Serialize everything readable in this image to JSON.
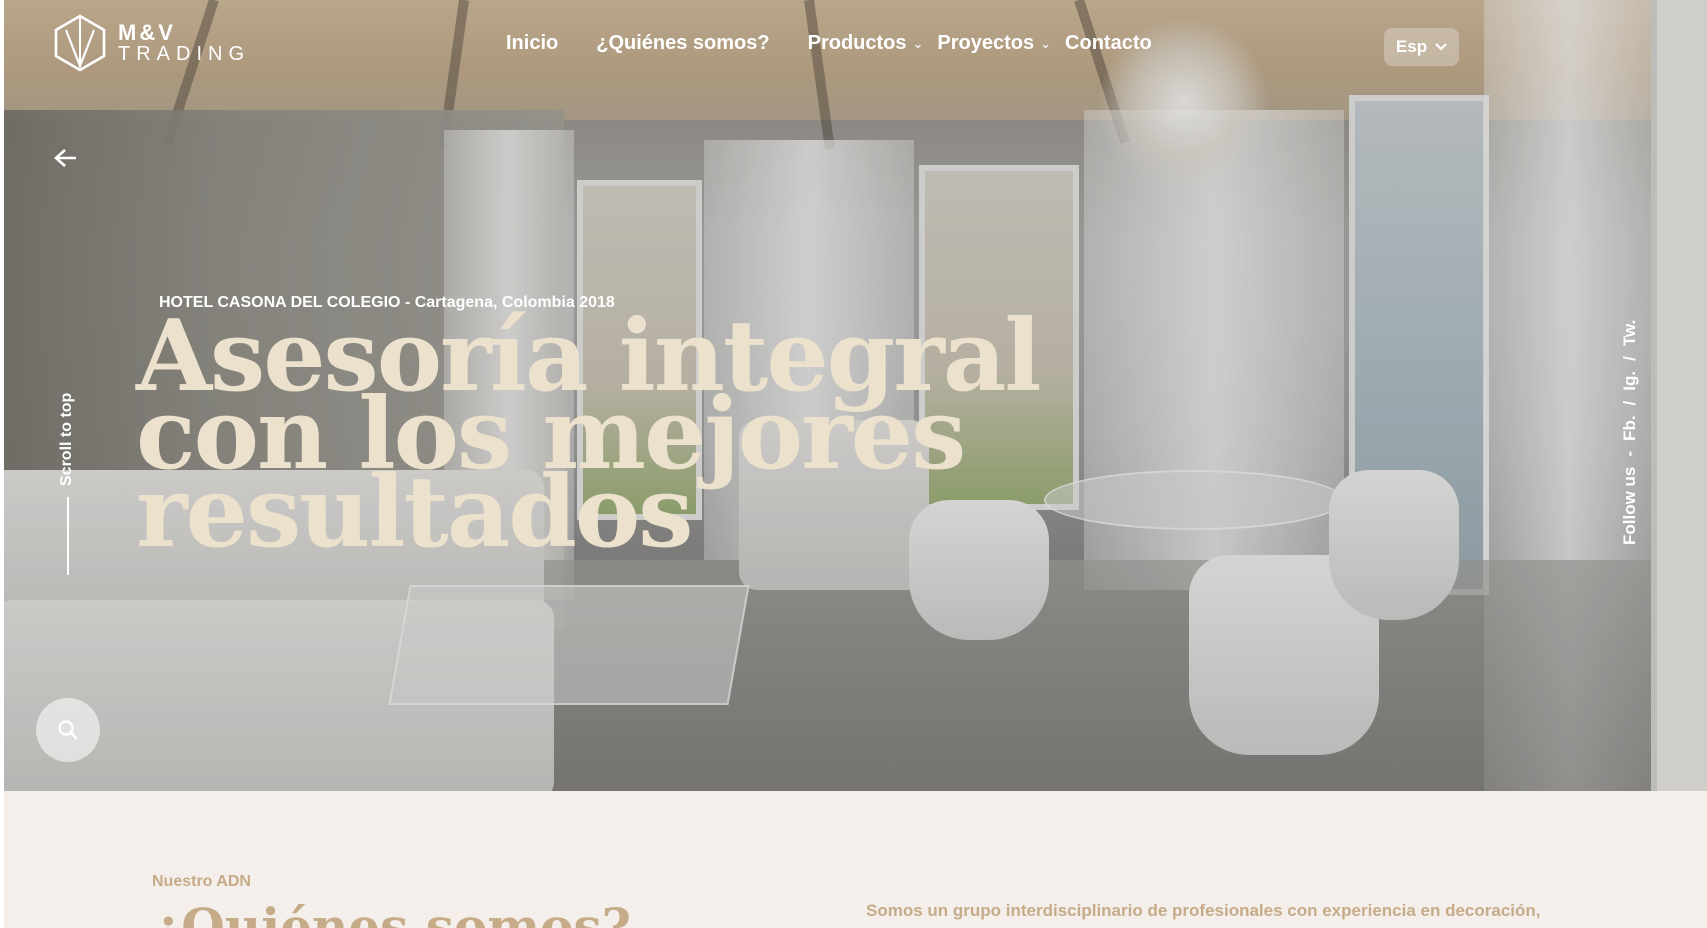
{
  "brand": {
    "line1": "M&V",
    "line2": "TRADING"
  },
  "nav": {
    "items": [
      {
        "label": "Inicio",
        "has_dropdown": false
      },
      {
        "label": "¿Quiénes somos?",
        "has_dropdown": false
      },
      {
        "label": "Productos",
        "has_dropdown": true
      },
      {
        "label": "Proyectos",
        "has_dropdown": true
      },
      {
        "label": "Contacto",
        "has_dropdown": false
      }
    ],
    "language": "Esp"
  },
  "hero": {
    "caption": "HOTEL CASONA DEL COLEGIO - Cartagena, Colombia 2018",
    "headline_lines": [
      "Asesoría integral",
      "con los mejores",
      "resultados"
    ],
    "scroll_to_top": "Scroll to top"
  },
  "social": {
    "follow_label": "Follow us",
    "separator": "-",
    "links": [
      "Fb.",
      "Ig.",
      "Tw."
    ],
    "divider": "/"
  },
  "about": {
    "label": "Nuestro ADN",
    "title": "¿Quiénes somos?",
    "text": "Somos un grupo interdisciplinario de profesionales con experiencia en decoración,"
  },
  "colors": {
    "accent": "#c6ab89",
    "headline": "#ebe1cc",
    "section_bg": "#f4efea"
  },
  "icons": {
    "back": "arrow-left-icon",
    "search": "search-icon",
    "dropdown": "chevron-down-icon"
  }
}
